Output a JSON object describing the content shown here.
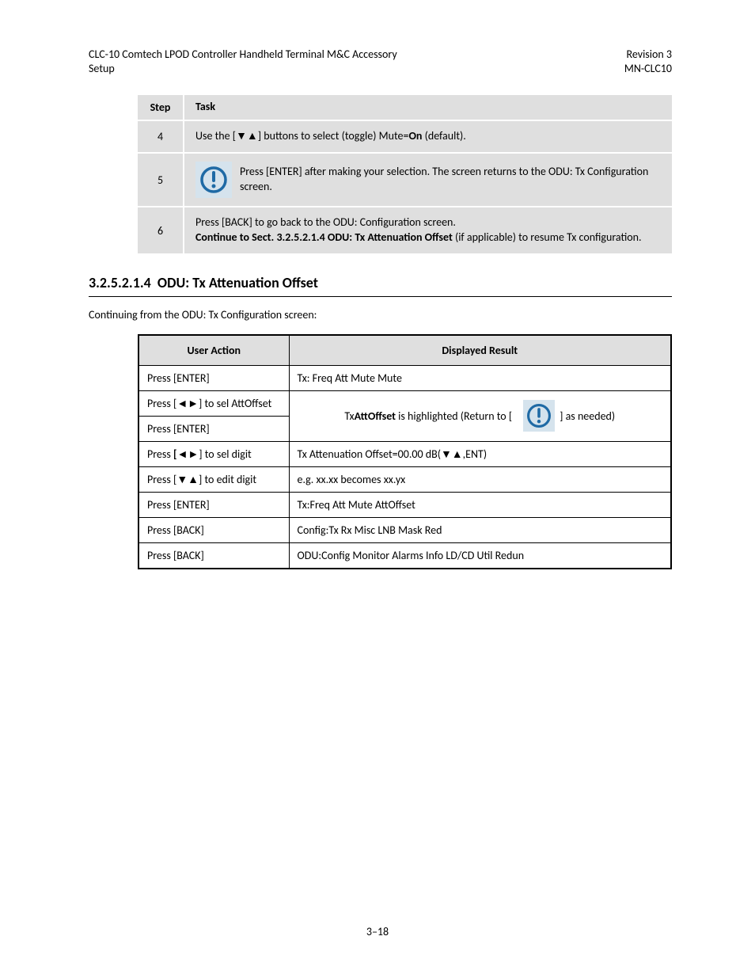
{
  "header": {
    "title_line1": "CLC-10 Comtech LPOD Controller Handheld Terminal M&C Accessory",
    "title_line2": "Setup",
    "right_line1": "Revision 3",
    "right_line2": "MN-CLC10"
  },
  "table1": {
    "hdr_step": "Step",
    "hdr_task": "Task",
    "rows": [
      {
        "step": "4",
        "task_pre": "Use the [",
        "task_post": "] buttons to select (toggle) Mute=",
        "task_bold": "On",
        "task_end": " (default)."
      },
      {
        "step": "5",
        "task_pre_icon": true,
        "task_text": "Press [ENTER] after making your selection. The screen returns to the ODU: Tx Configuration screen."
      },
      {
        "step": "6",
        "task_text": "Press [BACK] to go back to the ODU: Configuration screen.",
        "task_post_bold_pre": "Continue to Sect. 3.2.5.2.1.4 ODU: Tx Attenuation Offset",
        "task_after_bold": " (if applicable) to resume Tx configuration."
      }
    ]
  },
  "section": {
    "number": "3.2.5.2.1.4",
    "title": "ODU: Tx Attenuation Offset"
  },
  "body": "Continuing from the ODU: Tx Configuration screen:",
  "table2": {
    "hdr_action": "User Action",
    "hdr_result": "Displayed Result",
    "rows": [
      {
        "action": "Press [ENTER]",
        "result": "Tx: Freq Att Mute Mute"
      },
      {
        "action_pre": "Press [",
        "action_post": "] to sel AttOffset",
        "result_rowspan": 2,
        "result_hl": "AttOffset",
        "result_text_pre": "Tx ",
        "result_text_post": "is highlighted (Return to [",
        "result_after_icon": "] as needed)"
      },
      {
        "action": "Press [ENTER]"
      },
      {
        "action_pre": "Press ",
        "action_bold": "[",
        "action_post": "] to sel digit",
        "result": "Tx Attenuation Offset=00.00 dB(▼▲,ENT)"
      },
      {
        "action_pre": "Press [",
        "action_post": "] to edit digit",
        "result": "e.g. xx.xx becomes xx.yx"
      },
      {
        "action": "Press [ENTER]",
        "result": "Tx:Freq Att Mute AttOffset"
      },
      {
        "action": "Press [BACK]",
        "result": "Config:Tx Rx Misc LNB Mask Red"
      },
      {
        "action": "Press [BACK]",
        "result": "ODU:Config Monitor Alarms Info LD/CD Util Redun"
      }
    ]
  },
  "page_num": "3–18"
}
